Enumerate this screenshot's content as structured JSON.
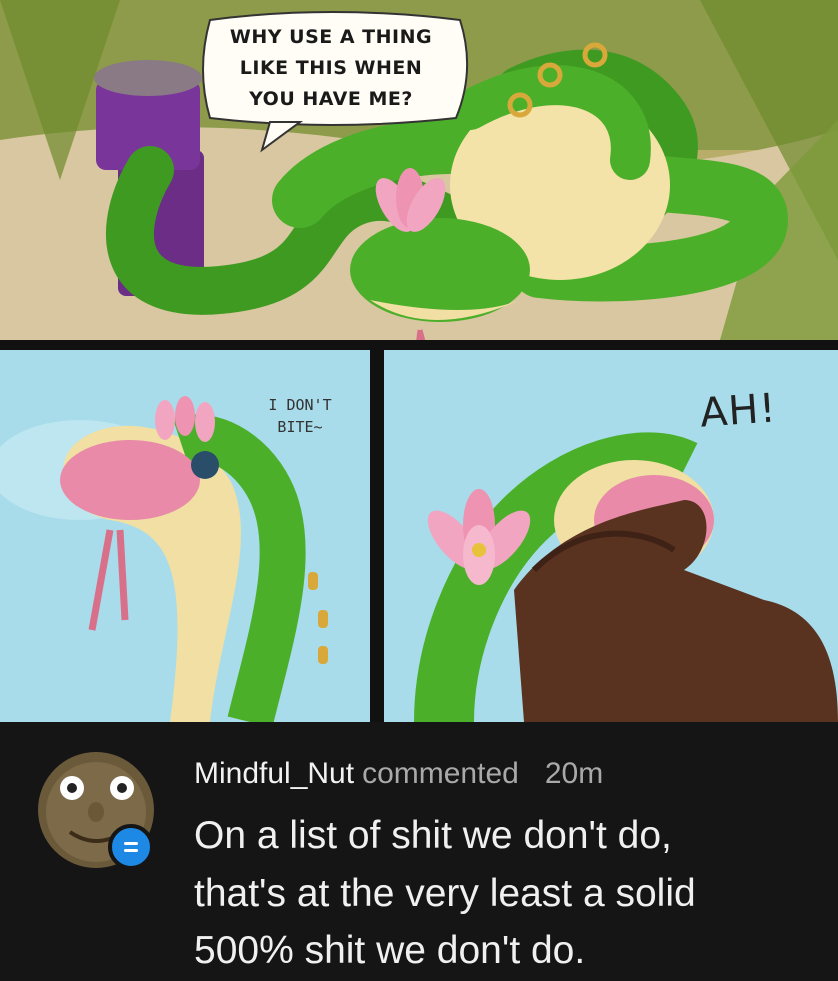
{
  "comic": {
    "panel1_speech": [
      "WHY USE A THING",
      "LIKE THIS WHEN",
      "YOU HAVE ME?"
    ],
    "panel2_speech": [
      "I DON'T",
      "BITE~"
    ],
    "panel3_exclaim": "AH!"
  },
  "comment": {
    "username": "Mindful_Nut",
    "action": "commented",
    "time": "20m",
    "text_lines": [
      "On a list of shit we don't do,",
      "that's at the very least a solid",
      "500% shit we don't do."
    ]
  },
  "colors": {
    "comment_bg": "#151515",
    "badge": "#1e88e5",
    "snake_green": "#4caf2a",
    "sky": "#a8dcea"
  }
}
